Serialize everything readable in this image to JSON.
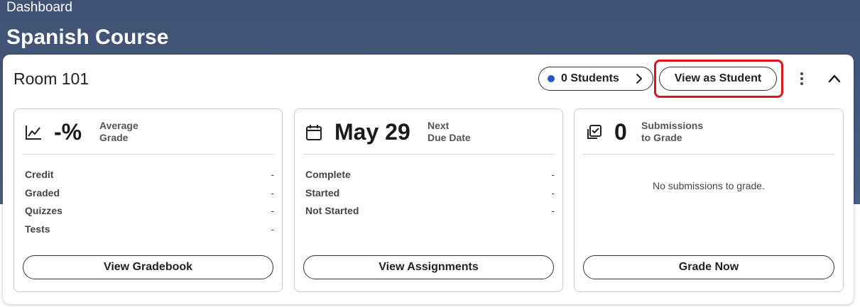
{
  "header": {
    "breadcrumb": "Dashboard",
    "title": "Spanish Course",
    "background_color": "#43567a"
  },
  "section": {
    "room_name": "Room 101",
    "students_label": "0 Students",
    "students_dot_color": "#2457c5",
    "view_as_student_label": "View as Student",
    "highlight_color": "#e0141e"
  },
  "panels": [
    {
      "icon": "chart-line-icon",
      "value": "-%",
      "label_line1": "Average",
      "label_line2": "Grade",
      "rows": [
        {
          "label": "Credit",
          "value": "-"
        },
        {
          "label": "Graded",
          "value": "-"
        },
        {
          "label": "Quizzes",
          "value": "-"
        },
        {
          "label": "Tests",
          "value": "-"
        }
      ],
      "button": "View Gradebook"
    },
    {
      "icon": "calendar-icon",
      "value": "May 29",
      "label_line1": "Next",
      "label_line2": "Due Date",
      "rows": [
        {
          "label": "Complete",
          "value": "-"
        },
        {
          "label": "Started",
          "value": "-"
        },
        {
          "label": "Not Started",
          "value": "-"
        }
      ],
      "button": "View Assignments"
    },
    {
      "icon": "checkbox-stack-icon",
      "value": "0",
      "label_line1": "Submissions",
      "label_line2": "to Grade",
      "empty_message": "No submissions to grade.",
      "button": "Grade Now"
    }
  ]
}
